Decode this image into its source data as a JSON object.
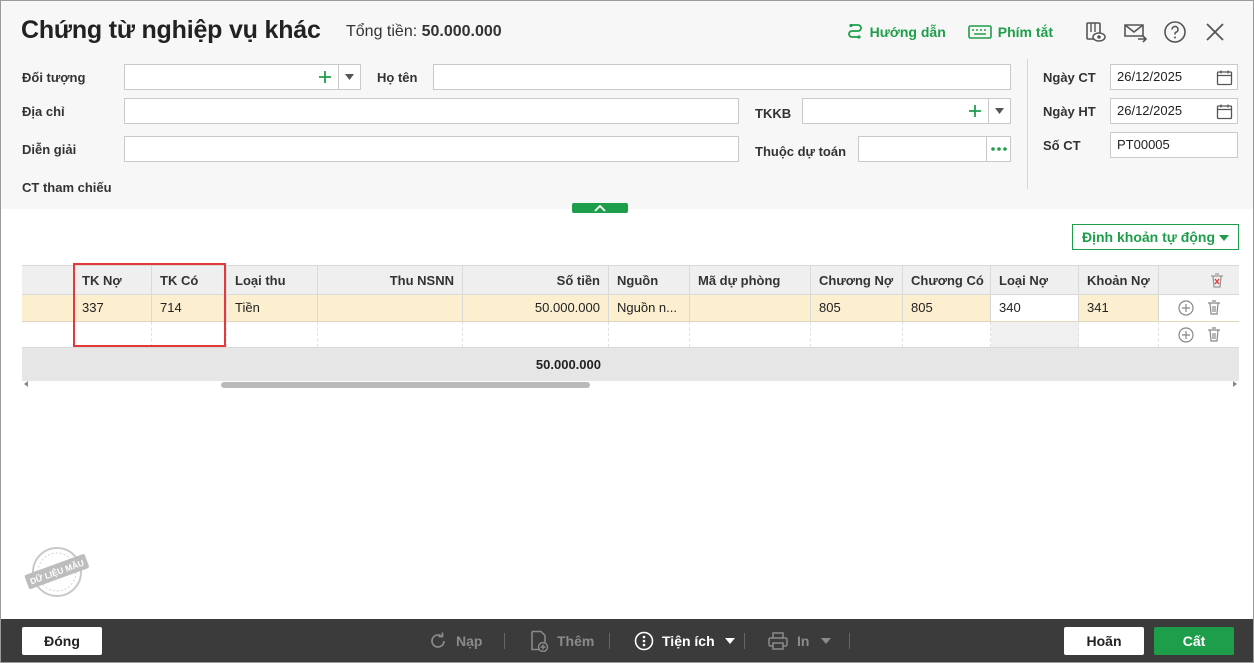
{
  "window": {
    "title": "Chứng từ nghiệp vụ khác",
    "total_label": "Tổng tiền:",
    "total_value": "50.000.000",
    "guide_label": "Hướng dẫn",
    "shortcut_label": "Phím tắt"
  },
  "form": {
    "doi_tuong_label": "Đối tượng",
    "doi_tuong_value": "",
    "ho_ten_label": "Họ tên",
    "ho_ten_value": "",
    "dia_chi_label": "Địa chỉ",
    "dia_chi_value": "",
    "tkkb_label": "TKKB",
    "tkkb_value": "",
    "dien_giai_label": "Diễn giải",
    "dien_giai_value": "",
    "thuoc_du_toan_label": "Thuộc dự toán",
    "thuoc_du_toan_value": "",
    "ct_tham_chieu_label": "CT tham chiếu",
    "ngay_ct_label": "Ngày CT",
    "ngay_ct_value": "26/12/2025",
    "ngay_ht_label": "Ngày HT",
    "ngay_ht_value": "26/12/2025",
    "so_ct_label": "Số CT",
    "so_ct_value": "PT00005"
  },
  "auto_posting_label": "Định khoản tự động",
  "grid": {
    "columns": [
      "TK Nợ",
      "TK Có",
      "Loại thu",
      "Thu NSNN",
      "Số tiền",
      "Nguồn",
      "Mã dự phòng",
      "Chương Nợ",
      "Chương Có",
      "Loại Nợ",
      "Khoản Nợ"
    ],
    "rows": [
      [
        "337",
        "714",
        "Tiền",
        "",
        "50.000.000",
        "Nguồn n...",
        "",
        "805",
        "805",
        "340",
        "341"
      ],
      [
        "",
        "",
        "",
        "",
        "",
        "",
        "",
        "",
        "",
        "",
        ""
      ]
    ],
    "footer_total": "50.000.000"
  },
  "stamp_text": "DỮ LIỆU MẪU",
  "bottom": {
    "close_label": "Đóng",
    "reload_label": "Nạp",
    "add_label": "Thêm",
    "utility_label": "Tiện ích",
    "print_label": "In",
    "cancel_label": "Hoãn",
    "save_label": "Cất"
  },
  "colors": {
    "accent": "#1e9e4a",
    "selected_row": "#fcefcf",
    "highlight_box": "#e23a3a",
    "bottom_bar": "#3b3b3b"
  }
}
